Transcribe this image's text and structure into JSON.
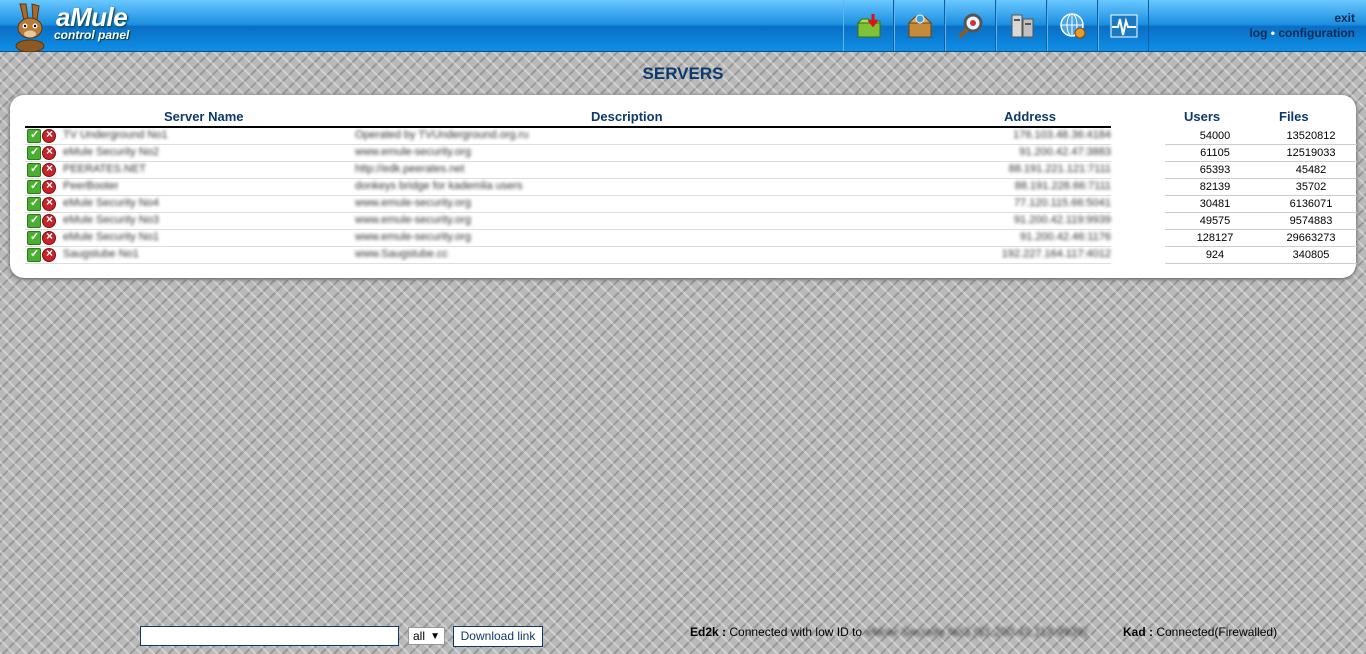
{
  "header": {
    "logo_title": "aMule",
    "logo_subtitle": "control panel",
    "links": {
      "exit": "exit",
      "log": "log",
      "separator": "•",
      "configuration": "configuration"
    },
    "toolbar_icons": [
      "downloads-icon",
      "shared-files-icon",
      "search-icon",
      "servers-icon",
      "kad-icon",
      "statistics-icon"
    ]
  },
  "page": {
    "title": "SERVERS"
  },
  "table": {
    "headers": {
      "name": "Server Name",
      "description": "Description",
      "address": "Address",
      "users": "Users",
      "files": "Files"
    },
    "rows": [
      {
        "name": "TV Underground No1",
        "description": "Operated by TVUnderground.org.ru",
        "address": "176.103.48.36:4184",
        "users": "54000",
        "files": "13520812"
      },
      {
        "name": "eMule Security No2",
        "description": "www.emule-security.org",
        "address": "91.200.42.47:3883",
        "users": "61105",
        "files": "12519033"
      },
      {
        "name": "PEERATES.NET",
        "description": "http://edk.peerates.net",
        "address": "88.191.221.121:7111",
        "users": "65393",
        "files": "45482"
      },
      {
        "name": "PeerBooter",
        "description": "donkeys bridge for kademlia users",
        "address": "88.191.228.66:7111",
        "users": "82139",
        "files": "35702"
      },
      {
        "name": "eMule Security No4",
        "description": "www.emule-security.org",
        "address": "77.120.115.66:5041",
        "users": "30481",
        "files": "6136071"
      },
      {
        "name": "eMule Security No3",
        "description": "www.emule-security.org",
        "address": "91.200.42.119:9939",
        "users": "49575",
        "files": "9574883"
      },
      {
        "name": "eMule Security No1",
        "description": "www.emule-security.org",
        "address": "91.200.42.46:1176",
        "users": "128127",
        "files": "29663273"
      },
      {
        "name": "Saugstube No1",
        "description": "www.Saugstube.cc",
        "address": "192.227.164.117:4012",
        "users": "924",
        "files": "340805"
      }
    ]
  },
  "footer": {
    "download_input_value": "",
    "category_select": "all",
    "download_button": "Download link",
    "ed2k_label": "Ed2k :",
    "ed2k_status": "Connected with low ID to",
    "ed2k_server": "eMule Security No3 (91.200.42.119:9939)",
    "kad_label": "Kad :",
    "kad_status": "Connected(Firewalled)"
  }
}
